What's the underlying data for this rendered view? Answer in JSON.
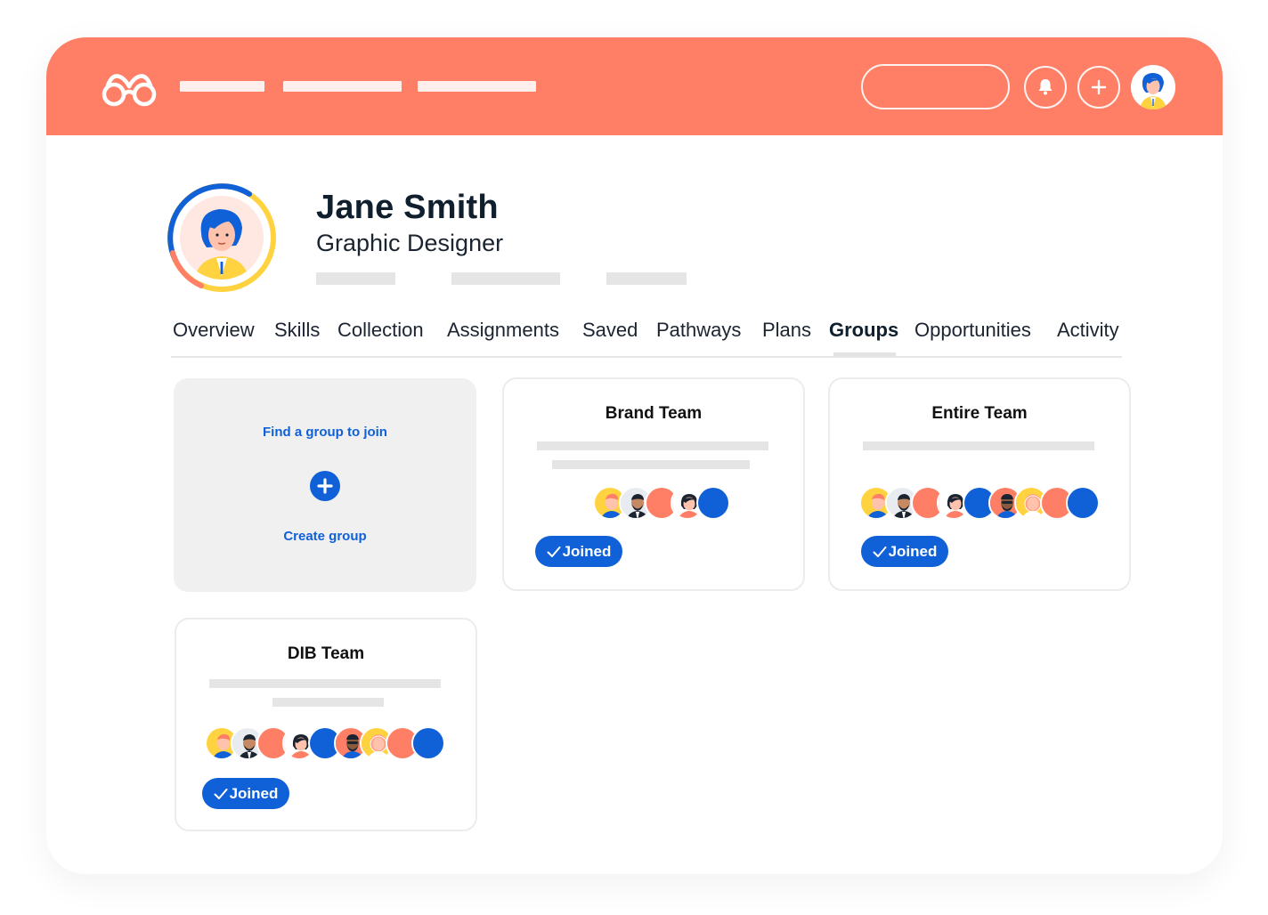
{
  "topbar": {
    "logo_icon": "glasses-logo-icon",
    "notification_icon": "bell-icon",
    "add_icon": "plus-icon",
    "avatar_icon": "user-avatar-icon",
    "color": "#ff7f66"
  },
  "profile": {
    "name": "Jane Smith",
    "title": "Graphic Designer",
    "ring_colors": [
      "#1060d8",
      "#ffd23f",
      "#ff7f66"
    ]
  },
  "tabs": [
    {
      "label": "Overview",
      "active": false
    },
    {
      "label": "Skills",
      "active": false
    },
    {
      "label": "Collection",
      "active": false
    },
    {
      "label": "Assignments",
      "active": false
    },
    {
      "label": "Saved",
      "active": false
    },
    {
      "label": "Pathways",
      "active": false
    },
    {
      "label": "Plans",
      "active": false
    },
    {
      "label": "Groups",
      "active": true
    },
    {
      "label": "Opportunities",
      "active": false
    },
    {
      "label": "Activity",
      "active": false
    }
  ],
  "find_card": {
    "find_label": "Find a group to join",
    "create_label": "Create group"
  },
  "groups": [
    {
      "title": "Brand Team",
      "member_avatars": [
        "yellow-person",
        "dark-person",
        "coral",
        "teal-person",
        "blue"
      ],
      "joined_label": "Joined"
    },
    {
      "title": "Entire Team",
      "member_avatars": [
        "yellow-person",
        "dark-person",
        "coral",
        "teal-person",
        "blue",
        "orange-person",
        "yellow-woman",
        "coral",
        "blue"
      ],
      "joined_label": "Joined"
    },
    {
      "title": "DIB Team",
      "member_avatars": [
        "yellow-person",
        "dark-person",
        "coral",
        "teal-person",
        "blue",
        "orange-person",
        "yellow-woman",
        "coral",
        "blue"
      ],
      "joined_label": "Joined"
    }
  ],
  "colors": {
    "accent": "#1060d8",
    "brand": "#ff7f66",
    "yellow": "#ffd23f"
  }
}
